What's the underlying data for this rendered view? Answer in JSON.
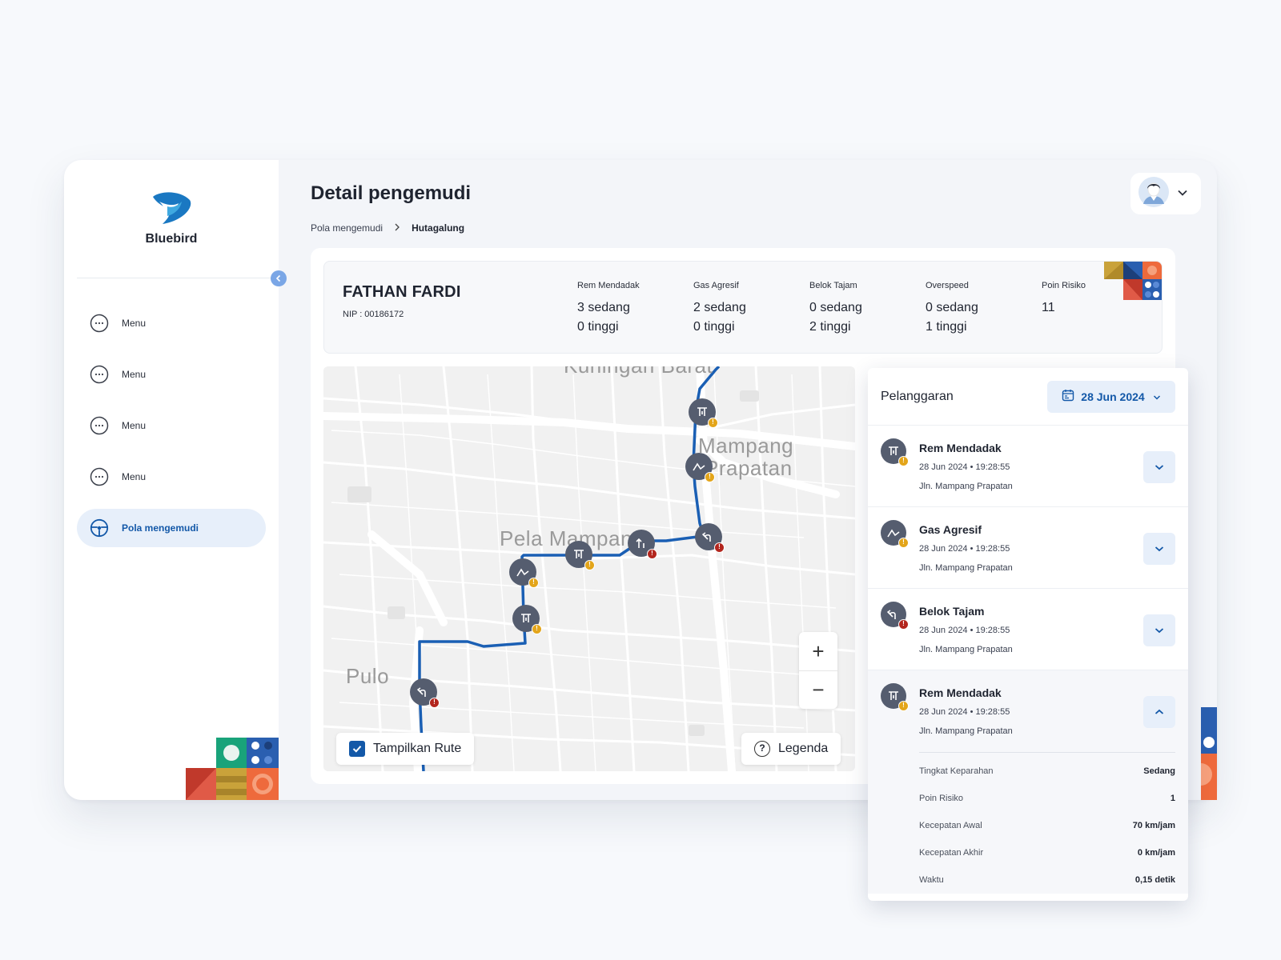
{
  "app": {
    "brand": "Bluebird"
  },
  "sidebar": {
    "items": [
      {
        "label": "Menu",
        "icon": "dots-circle-icon"
      },
      {
        "label": "Menu",
        "icon": "dots-circle-icon"
      },
      {
        "label": "Menu",
        "icon": "dots-circle-icon"
      },
      {
        "label": "Menu",
        "icon": "dots-circle-icon"
      },
      {
        "label": "Pola mengemudi",
        "icon": "steering-wheel-icon",
        "active": true
      }
    ]
  },
  "header": {
    "title": "Detail pengemudi",
    "breadcrumb": [
      "Pola mengemudi",
      "Hutagalung"
    ]
  },
  "driver": {
    "name": "FATHAN FARDI",
    "nip": "NIP : 00186172",
    "stats": [
      {
        "label": "Rem Mendadak",
        "line1": "3 sedang",
        "line2": "0 tinggi"
      },
      {
        "label": "Gas Agresif",
        "line1": "2 sedang",
        "line2": "0 tinggi"
      },
      {
        "label": "Belok Tajam",
        "line1": "0 sedang",
        "line2": "2 tinggi"
      },
      {
        "label": "Overspeed",
        "line1": "0 sedang",
        "line2": "1 tinggi"
      },
      {
        "label": "Poin Risiko",
        "line1": "11",
        "line2": ""
      }
    ]
  },
  "map": {
    "labels": [
      "Kuningan Barat",
      "Mampang",
      "Prapatan",
      "Pela Mampang",
      "Pulo"
    ],
    "show_route_label": "Tampilkan Rute",
    "show_route_checked": true,
    "legend_label": "Legenda",
    "zoom_in": "+",
    "zoom_out": "−"
  },
  "violations": {
    "title": "Pelanggaran",
    "date": "28 Jun 2024",
    "items": [
      {
        "type": "Rem Mendadak",
        "time": "28 Jun 2024 • 19:28:55",
        "location": "Jln. Mampang Prapatan",
        "severity": "warn",
        "icon": "brake-icon"
      },
      {
        "type": "Gas Agresif",
        "time": "28 Jun 2024 • 19:28:55",
        "location": "Jln. Mampang Prapatan",
        "severity": "warn",
        "icon": "acceleration-icon"
      },
      {
        "type": "Belok Tajam",
        "time": "28 Jun 2024 • 19:28:55",
        "location": "Jln. Mampang Prapatan",
        "severity": "danger",
        "icon": "sharp-turn-icon"
      },
      {
        "type": "Rem Mendadak",
        "time": "28 Jun 2024 • 19:28:55",
        "location": "Jln. Mampang Prapatan",
        "severity": "warn",
        "icon": "brake-icon",
        "expanded": true,
        "details": [
          {
            "key": "Tingkat Keparahan",
            "value": "Sedang"
          },
          {
            "key": "Poin Risiko",
            "value": "1"
          },
          {
            "key": "Kecepatan Awal",
            "value": "70 km/jam"
          },
          {
            "key": "Kecepatan Akhir",
            "value": "0 km/jam"
          },
          {
            "key": "Waktu",
            "value": "0,15 detik"
          }
        ]
      }
    ]
  },
  "colors": {
    "primary": "#1358a8",
    "route": "#1a5fb4",
    "warn": "#e3a51a",
    "danger": "#b3261e",
    "marker": "#555d6f"
  }
}
